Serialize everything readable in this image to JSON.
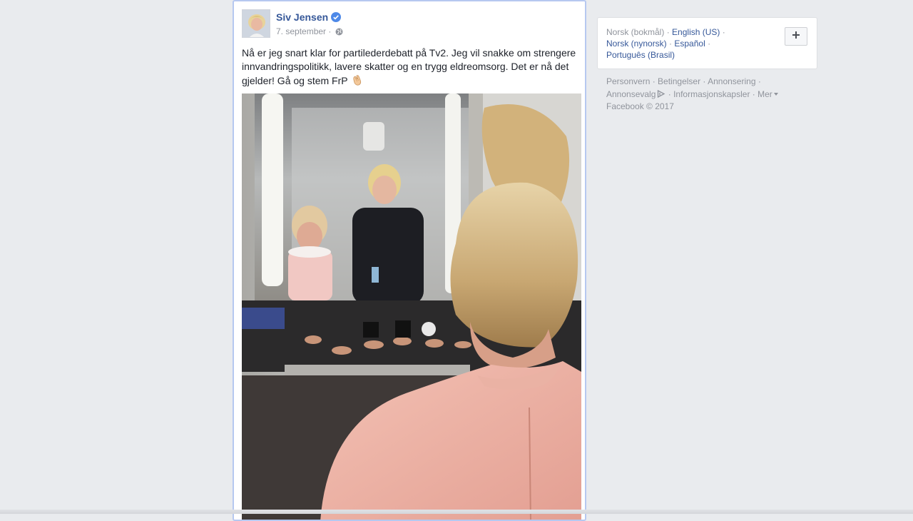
{
  "post": {
    "author": "Siv Jensen",
    "date": "7. september",
    "meta_separator": "·",
    "text": "Nå er jeg snart klar for partilederdebatt på Tv2. Jeg vil snakke om strengere innvandringspolitikk, lavere skatter og en trygg eldreomsorg. Det er nå det gjelder! Gå og stem FrP",
    "emoji": "clapping-hands-emoji",
    "privacy_icon": "globe-icon",
    "verified_icon": "verified-badge-icon"
  },
  "languages": {
    "items": [
      {
        "label": "Norsk (bokmål)",
        "current": true
      },
      {
        "label": "English (US)",
        "current": false
      },
      {
        "label": "Norsk (nynorsk)",
        "current": false
      },
      {
        "label": "Español",
        "current": false
      },
      {
        "label": "Português (Brasil)",
        "current": false
      }
    ],
    "add_button_icon": "plus-icon"
  },
  "footer": {
    "personvern": "Personvern",
    "betingelser": "Betingelser",
    "annonsering": "Annonsering",
    "annonsevalg": "Annonsevalg",
    "informasjonskapsler": "Informasjonskapsler",
    "mer": "Mer",
    "copyright": "Facebook © 2017"
  },
  "colors": {
    "link": "#365899",
    "muted": "#90949c",
    "background": "#e9ebee",
    "post_border": "#b6c8f0"
  }
}
